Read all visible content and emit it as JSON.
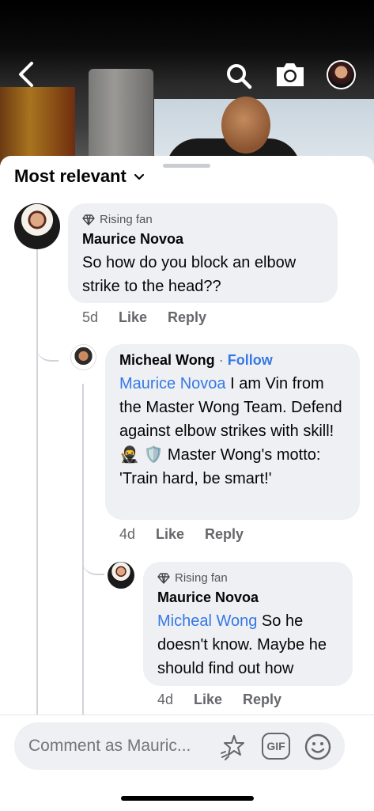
{
  "header": {
    "back_icon": "chevron-left-icon",
    "search_icon": "search-icon",
    "camera_icon": "camera-icon",
    "profile_icon": "profile-avatar"
  },
  "sort": {
    "label": "Most relevant",
    "icon": "chevron-down-icon"
  },
  "comments": [
    {
      "badge": "Rising fan",
      "author": "Maurice Novoa",
      "text": "So how do you block an elbow strike to the head??",
      "time": "5d",
      "like": "Like",
      "reply": "Reply"
    },
    {
      "author": "Micheal Wong",
      "separator": "·",
      "follow": "Follow",
      "mention": "Maurice Novoa",
      "text": "I am Vin from the Master Wong Team. Defend against elbow strikes with skill! 🥷 🛡️ Master Wong's motto: 'Train hard, be smart!'",
      "time": "4d",
      "like": "Like",
      "reply": "Reply"
    },
    {
      "badge": "Rising fan",
      "author": "Maurice Novoa",
      "mention": "Micheal Wong",
      "text": "So he doesn't know. Maybe he should find out how",
      "time": "4d",
      "like": "Like",
      "reply": "Reply"
    }
  ],
  "composer": {
    "placeholder": "Comment as Mauric...",
    "avatar_icon": "avatar-sticker-icon",
    "gif_label": "GIF",
    "emoji_icon": "smiley-icon"
  },
  "colors": {
    "link": "#3578e5",
    "bubble": "#eff0f4",
    "meta": "#65676b"
  }
}
